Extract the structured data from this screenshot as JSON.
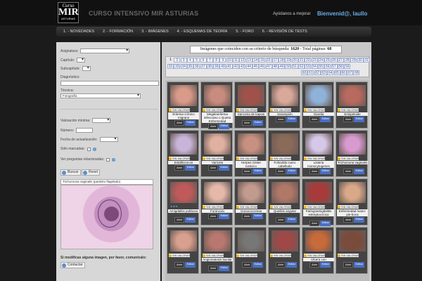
{
  "header": {
    "logo_top": "Curso",
    "logo_main": "MIR",
    "logo_bottom": "ASTURIAS",
    "site_title": "CURSO INTENSIVO MIR ASTURIAS",
    "help_link": "Ayúdanos a mejorar",
    "welcome": "Bienvenid@, laullo"
  },
  "nav": [
    "1. - NOVEDADES",
    "2. - FORMACIÓN",
    "3. - IMÁGENES",
    "4. - ESQUEMAS DE TEORÍA",
    "5. - FORO",
    "6. - REVISIÓN DE TESTS"
  ],
  "filters": {
    "asignatura": "Asignatura:",
    "capitulo": "Capítulo:",
    "subcapitulo": "Subcapítulo:",
    "diagnostico": "Diagnóstico:",
    "tecnica": "Técnica:",
    "tecnica_value": "Fotografía",
    "valoracion": "Valoración mínima:",
    "numero": "Número:",
    "fecha": "Fecha de actualización:",
    "solo_marcadas": "Sólo marcadas:",
    "ver_preguntas": "Ver preguntas relacionadas:",
    "buscar": "Buscar",
    "reset": "Reset",
    "preview_caption": "Trichomona vaginalis (parásito flagelado)",
    "modify_text": "Si modificas alguna imagen, por favor, comunícalo:",
    "contactar": "Contactar"
  },
  "results": {
    "prefix": "Imágenes que coinciden con su criterio de búsqueda:",
    "count": "1620",
    "pages_label": "- Total páginas:",
    "pages": "68"
  },
  "pagination": [
    [
      "1",
      "2",
      "3",
      "4",
      "5",
      "6",
      "7",
      "8",
      "9",
      "10",
      "11",
      "12",
      "13",
      "14",
      "15",
      "16",
      "17",
      "18",
      "19",
      "20",
      "21",
      "22",
      "23",
      "24",
      "25",
      "26",
      "27",
      "28",
      "29",
      "30",
      "31"
    ],
    [
      "32",
      "33",
      "34",
      "35",
      "36",
      "37",
      "38",
      "39",
      "40",
      "41",
      "42",
      "43",
      "44",
      "45",
      "46",
      "47",
      "48",
      "49",
      "50",
      "51",
      "52",
      "53",
      "54",
      "55",
      "56",
      "57",
      "58",
      "59"
    ],
    [
      "60",
      "61",
      "62",
      "63",
      "64",
      "65",
      "66",
      "67",
      "68"
    ]
  ],
  "card_labels": {
    "sin_valorar": "SIN VALORAR",
    "abrir": "Abrir",
    "editar": "Editar"
  },
  "cards": [
    {
      "name": "Eritema crónico migrans",
      "color": "#d99a8a"
    },
    {
      "name": "Megaloeritema infeccioso o Quinta Enfermedad",
      "color": "#c98b7e"
    },
    {
      "name": "Sarcoma de kaposi",
      "color": "#a0524a"
    },
    {
      "name": "Sarampión",
      "color": "#d8a89a"
    },
    {
      "name": "Giardia",
      "color": "#8fb2d8"
    },
    {
      "name": "Erisipeloide",
      "color": "#b96a5e"
    },
    {
      "name": "Estafilococos",
      "color": "#c8b4d8"
    },
    {
      "name": "Varicela",
      "color": "#e0b0a0"
    },
    {
      "name": "Herpes zóster torácico",
      "color": "#c89080"
    },
    {
      "name": "Foliculitis cuero cabelludo",
      "color": "#8a6a58"
    },
    {
      "name": "Listeria monocytogenes",
      "color": "#d6c8e8"
    },
    {
      "name": "Trichomona vaginalis",
      "color": "#d99ad0"
    },
    {
      "name": "Amigdalitis pultácea",
      "color": "#c05a5a",
      "stars": "★★★"
    },
    {
      "name": "Forúnculo",
      "color": "#e6b8aa"
    },
    {
      "name": "Gonococcemia",
      "color": "#c29a8e"
    },
    {
      "name": "Queilitis angular",
      "color": "#b07868"
    },
    {
      "name": "Faringoamigdalitis estreptocócica",
      "color": "#a83a3a"
    },
    {
      "name": "Enfermedad mano-pie-boca",
      "color": "#d8a888"
    },
    {
      "name": "",
      "color": "#d8a08e"
    },
    {
      "name": "Angiomatosis bacilar",
      "color": "#b87870"
    },
    {
      "name": "",
      "color": "#777777"
    },
    {
      "name": "",
      "color": "#a04848"
    },
    {
      "name": "Úlcera con",
      "color": "#c86a3a"
    },
    {
      "name": "",
      "color": "#7a4a3a"
    }
  ]
}
